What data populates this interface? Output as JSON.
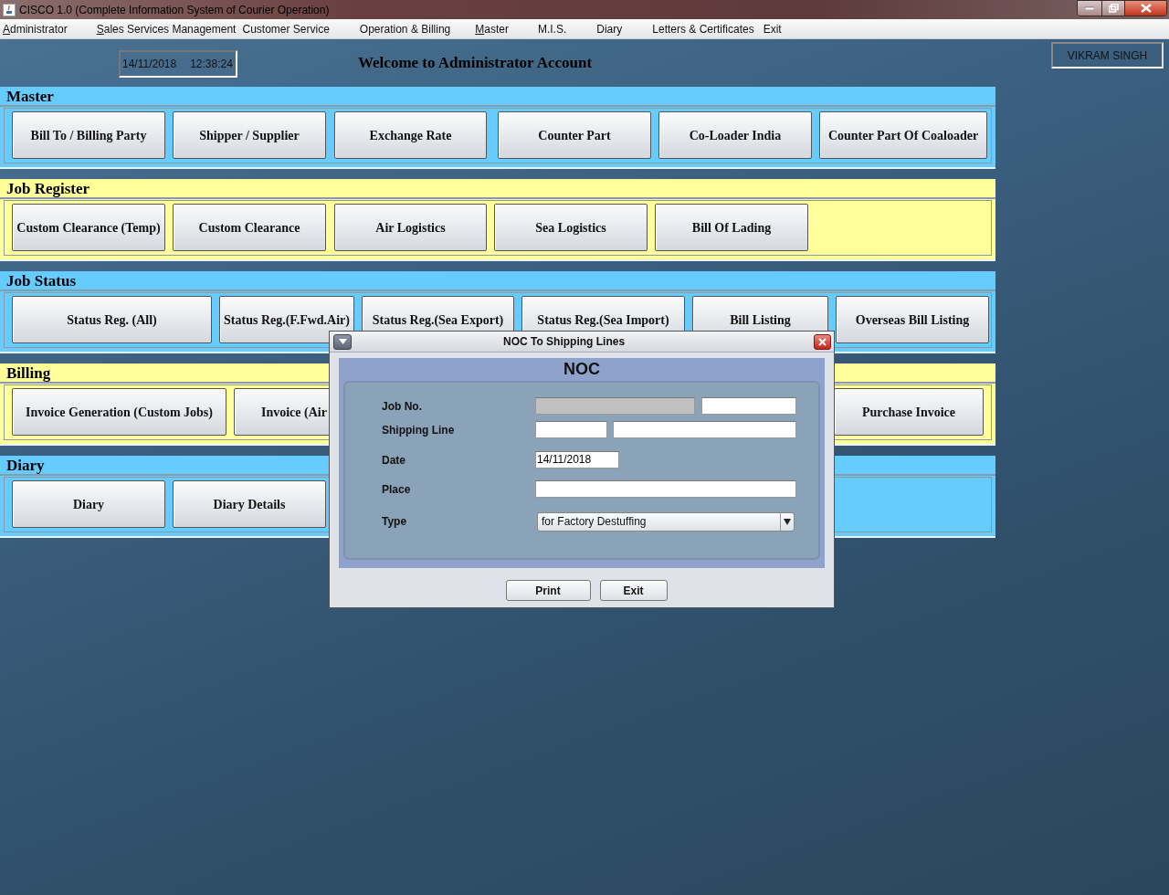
{
  "window": {
    "title": "CISCO 1.0 (Complete Information System of Courier Operation)"
  },
  "menu": [
    {
      "label": "Administrator",
      "mnemonic": true
    },
    {
      "label": "Sales Services Management",
      "mnemonic": true
    },
    {
      "label": "Customer Service",
      "mnemonic": false
    },
    {
      "label": "Operation & Billing",
      "mnemonic": false
    },
    {
      "label": "Master",
      "mnemonic": true
    },
    {
      "label": "M.I.S.",
      "mnemonic": false
    },
    {
      "label": "Diary",
      "mnemonic": false
    },
    {
      "label": "Letters & Certificates",
      "mnemonic": false
    },
    {
      "label": "Exit",
      "mnemonic": false
    }
  ],
  "header": {
    "date": "14/11/2018",
    "time": "12:38:24",
    "welcome": "Welcome to Administrator Account",
    "user": "VIKRAM SINGH"
  },
  "sections": [
    {
      "title": "Master",
      "color": "#66ccff",
      "buttons": [
        "Bill To / Billing Party",
        "Shipper / Supplier",
        "Exchange Rate",
        "Counter Part",
        "Co-Loader India",
        "Counter Part Of Coaloader"
      ]
    },
    {
      "title": "Job Register",
      "color": "#ffff99",
      "buttons": [
        "Custom Clearance (Temp)",
        "Custom Clearance",
        "Air Logistics",
        "Sea Logistics",
        "Bill Of Lading"
      ]
    },
    {
      "title": "Job Status",
      "color": "#66ccff",
      "buttons": [
        "Status Reg. (All)",
        "Status Reg.(F.Fwd.Air)",
        "Status Reg.(Sea Export)",
        "Status Reg.(Sea Import)",
        "Bill Listing",
        "Overseas Bill Listing"
      ]
    },
    {
      "title": "Billing",
      "color": "#ffff99",
      "buttons": [
        "Invoice Generation (Custom Jobs)",
        "Invoice (Air",
        "Purchase Invoice"
      ]
    },
    {
      "title": "Diary",
      "color": "#66ccff",
      "buttons": [
        "Diary",
        "Diary Details"
      ]
    }
  ],
  "dialog": {
    "title": "NOC To Shipping Lines",
    "heading": "NOC",
    "fields": [
      {
        "label": "Job No.",
        "kind": "job"
      },
      {
        "label": "Shipping Line",
        "kind": "pair"
      },
      {
        "label": "Date",
        "kind": "date",
        "value": "14/11/2018"
      },
      {
        "label": "Place",
        "kind": "text"
      },
      {
        "label": "Type",
        "kind": "select",
        "value": "for Factory Destuffing"
      }
    ],
    "buttons": [
      "Print",
      "Exit"
    ]
  }
}
